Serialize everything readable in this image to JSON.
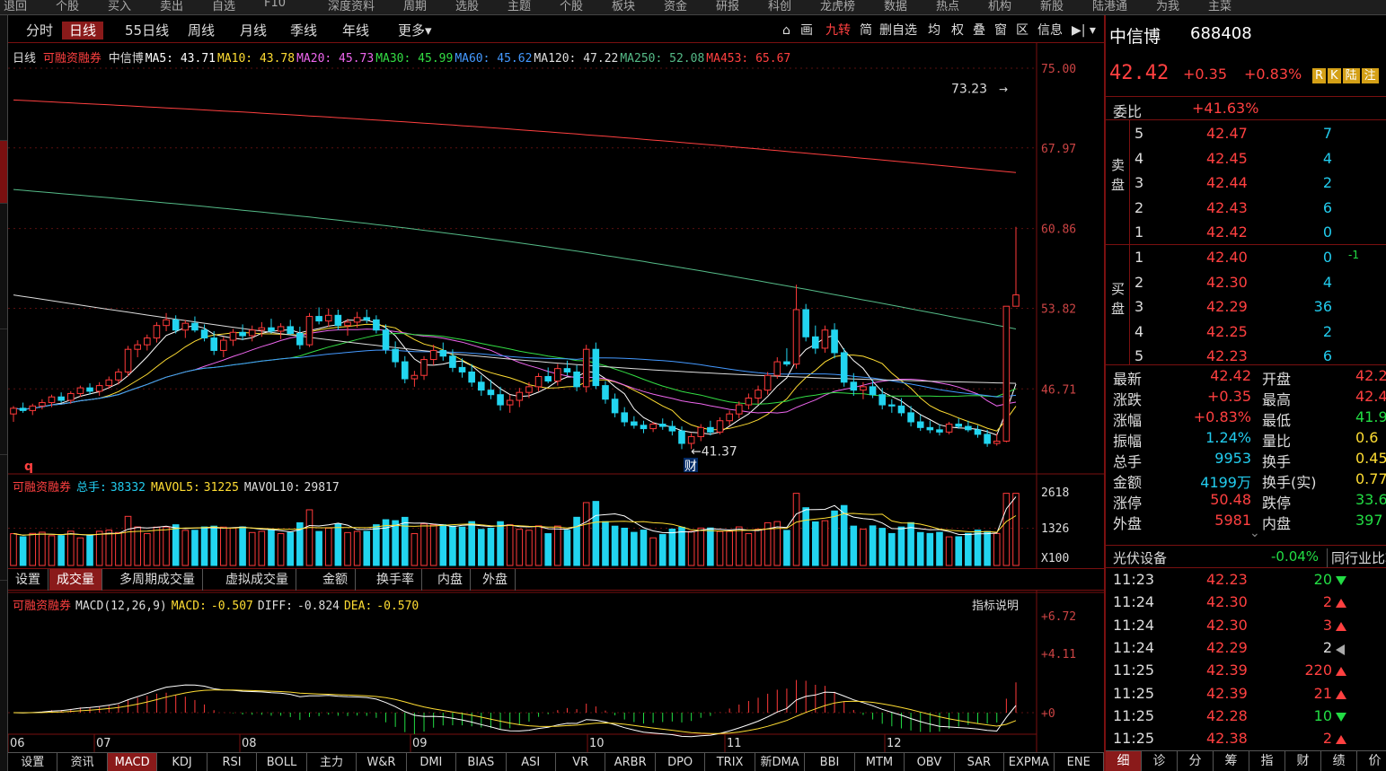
{
  "top_menu": [
    "退回",
    "个股",
    "买入",
    "卖出",
    "自选",
    "F10",
    "深度资料",
    "周期",
    "选股",
    "主题",
    "个股",
    "板块",
    "资金",
    "研报",
    "科创",
    "龙虎榜",
    "数据",
    "热点",
    "机构",
    "新股",
    "陆港通",
    "为我",
    "主菜"
  ],
  "period_tabs": [
    {
      "label": "分时",
      "active": false
    },
    {
      "label": "日线",
      "active": true
    },
    {
      "label": "55日线",
      "active": false
    },
    {
      "label": "周线",
      "active": false
    },
    {
      "label": "月线",
      "active": false
    },
    {
      "label": "季线",
      "active": false
    },
    {
      "label": "年线",
      "active": false
    },
    {
      "label": "更多▾",
      "active": false
    }
  ],
  "toolbar": [
    "画",
    "九转",
    "简",
    "删自选",
    "均",
    "权",
    "叠",
    "窗",
    "区",
    "信息"
  ],
  "chart_header": {
    "period": "日线",
    "tag": "可融资融券",
    "name": "中信博",
    "ma": [
      {
        "label": "MA5:",
        "value": "43.71",
        "color": "#ffffff"
      },
      {
        "label": "MA10:",
        "value": "43.78",
        "color": "#ffdd33"
      },
      {
        "label": "MA20:",
        "value": "45.73",
        "color": "#ee66ee"
      },
      {
        "label": "MA30:",
        "value": "45.99",
        "color": "#33dd44"
      },
      {
        "label": "MA60:",
        "value": "45.62",
        "color": "#4499ff"
      },
      {
        "label": "MA120:",
        "value": "47.22",
        "color": "#dddddd"
      },
      {
        "label": "MA250:",
        "value": "52.08",
        "color": "#55bb88"
      },
      {
        "label": "MA453:",
        "value": "65.67",
        "color": "#ff4040"
      }
    ]
  },
  "price_axis": [
    "75.00",
    "67.97",
    "60.86",
    "53.82",
    "46.71"
  ],
  "annotations": {
    "high": "73.23",
    "low": "41.37",
    "fin_mark": "财",
    "q_mark": "q"
  },
  "volume_header": {
    "tag": "可融资融券",
    "total_label": "总手:",
    "total": "38332",
    "mavol5_label": "MAVOL5:",
    "mavol5": "31225",
    "mavol10_label": "MAVOL10:",
    "mavol10": "29817"
  },
  "volume_axis": [
    "2618",
    "1326",
    "X100"
  ],
  "volume_tabs": [
    {
      "label": "设置",
      "active": false
    },
    {
      "label": "成交量",
      "active": true
    },
    {
      "label": "多周期成交量",
      "active": false
    },
    {
      "label": "虚拟成交量",
      "active": false
    },
    {
      "label": "金额",
      "active": false
    },
    {
      "label": "换手率",
      "active": false
    },
    {
      "label": "内盘",
      "active": false
    },
    {
      "label": "外盘",
      "active": false
    }
  ],
  "macd_header": {
    "tag": "可融资融券",
    "name": "MACD(12,26,9)",
    "macd_label": "MACD:",
    "macd": "-0.507",
    "diff_label": "DIFF:",
    "diff": "-0.824",
    "dea_label": "DEA:",
    "dea": "-0.570",
    "explain": "指标说明"
  },
  "macd_axis": [
    "+6.72",
    "+4.11",
    "+0"
  ],
  "date_axis": [
    "06",
    "07",
    "08",
    "09",
    "10",
    "11",
    "12"
  ],
  "indicator_tabs": [
    {
      "label": "设置",
      "active": false
    },
    {
      "label": "资讯",
      "active": false
    },
    {
      "label": "MACD",
      "active": true
    },
    {
      "label": "KDJ",
      "active": false
    },
    {
      "label": "RSI",
      "active": false
    },
    {
      "label": "BOLL",
      "active": false
    },
    {
      "label": "主力",
      "active": false
    },
    {
      "label": "W&R",
      "active": false
    },
    {
      "label": "DMI",
      "active": false
    },
    {
      "label": "BIAS",
      "active": false
    },
    {
      "label": "ASI",
      "active": false
    },
    {
      "label": "VR",
      "active": false
    },
    {
      "label": "ARBR",
      "active": false
    },
    {
      "label": "DPO",
      "active": false
    },
    {
      "label": "TRIX",
      "active": false
    },
    {
      "label": "新DMA",
      "active": false
    },
    {
      "label": "BBI",
      "active": false
    },
    {
      "label": "MTM",
      "active": false
    },
    {
      "label": "OBV",
      "active": false
    },
    {
      "label": "SAR",
      "active": false
    },
    {
      "label": "EXPMA",
      "active": false
    },
    {
      "label": "ENE",
      "active": false
    }
  ],
  "stock": {
    "name": "中信博",
    "code": "688408",
    "price": "42.42",
    "change": "+0.35",
    "pct": "+0.83%",
    "badges": [
      "R",
      "K",
      "陆",
      "注"
    ]
  },
  "order_book": {
    "weibi_label": "委比",
    "weibi": "+41.63%",
    "sell_label": "卖盘",
    "buy_label": "买盘",
    "sell": [
      {
        "lvl": "5",
        "price": "42.47",
        "vol": "7"
      },
      {
        "lvl": "4",
        "price": "42.45",
        "vol": "4"
      },
      {
        "lvl": "3",
        "price": "42.44",
        "vol": "2"
      },
      {
        "lvl": "2",
        "price": "42.43",
        "vol": "6"
      },
      {
        "lvl": "1",
        "price": "42.42",
        "vol": "0"
      }
    ],
    "buy": [
      {
        "lvl": "1",
        "price": "42.40",
        "vol": "0",
        "extra": "-1"
      },
      {
        "lvl": "2",
        "price": "42.30",
        "vol": "4"
      },
      {
        "lvl": "3",
        "price": "42.29",
        "vol": "36"
      },
      {
        "lvl": "4",
        "price": "42.25",
        "vol": "2"
      },
      {
        "lvl": "5",
        "price": "42.23",
        "vol": "6"
      }
    ]
  },
  "quote_stats": [
    {
      "l1": "最新",
      "v1": "42.42",
      "c1": "red",
      "l2": "开盘",
      "v2": "42.2",
      "c2": "red"
    },
    {
      "l1": "涨跌",
      "v1": "+0.35",
      "c1": "red",
      "l2": "最高",
      "v2": "42.4",
      "c2": "red"
    },
    {
      "l1": "涨幅",
      "v1": "+0.83%",
      "c1": "red",
      "l2": "最低",
      "v2": "41.9",
      "c2": "grn"
    },
    {
      "l1": "振幅",
      "v1": "1.24%",
      "c1": "cyan",
      "l2": "量比",
      "v2": "0.6",
      "c2": "yellow"
    },
    {
      "l1": "总手",
      "v1": "9953",
      "c1": "cyan",
      "l2": "换手",
      "v2": "0.45",
      "c2": "yellow"
    },
    {
      "l1": "金额",
      "v1": "4199万",
      "c1": "cyan",
      "l2": "换手(实)",
      "v2": "0.77",
      "c2": "yellow"
    },
    {
      "l1": "涨停",
      "v1": "50.48",
      "c1": "red",
      "l2": "跌停",
      "v2": "33.6",
      "c2": "grn"
    },
    {
      "l1": "外盘",
      "v1": "5981",
      "c1": "red",
      "l2": "内盘",
      "v2": "397",
      "c2": "grn"
    }
  ],
  "industry": {
    "name": "光伏设备",
    "pct": "-0.04%",
    "compare": "同行业比较"
  },
  "ticks": [
    {
      "time": "11:23",
      "price": "42.23",
      "pcolor": "red",
      "vol": "20",
      "vcolor": "grn",
      "dir": "down"
    },
    {
      "time": "11:24",
      "price": "42.30",
      "pcolor": "red",
      "vol": "2",
      "vcolor": "red",
      "dir": "up"
    },
    {
      "time": "11:24",
      "price": "42.30",
      "pcolor": "red",
      "vol": "3",
      "vcolor": "red",
      "dir": "up"
    },
    {
      "time": "11:24",
      "price": "42.29",
      "pcolor": "red",
      "vol": "2",
      "vcolor": "white",
      "dir": "left"
    },
    {
      "time": "11:25",
      "price": "42.39",
      "pcolor": "red",
      "vol": "220",
      "vcolor": "red",
      "dir": "up"
    },
    {
      "time": "11:25",
      "price": "42.39",
      "pcolor": "red",
      "vol": "21",
      "vcolor": "red",
      "dir": "up"
    },
    {
      "time": "11:25",
      "price": "42.28",
      "pcolor": "red",
      "vol": "10",
      "vcolor": "grn",
      "dir": "down"
    },
    {
      "time": "11:25",
      "price": "42.38",
      "pcolor": "red",
      "vol": "2",
      "vcolor": "red",
      "dir": "up"
    }
  ],
  "right_bottom_tabs": [
    {
      "label": "细",
      "active": true
    },
    {
      "label": "诊",
      "active": false
    },
    {
      "label": "分",
      "active": false
    },
    {
      "label": "筹",
      "active": false
    },
    {
      "label": "指",
      "active": false
    },
    {
      "label": "财",
      "active": false
    },
    {
      "label": "绩",
      "active": false
    },
    {
      "label": "价",
      "active": false
    }
  ],
  "chart_data": {
    "type": "candlestick",
    "ylim": [
      40,
      75
    ],
    "x_labels": [
      "06",
      "07",
      "08",
      "09",
      "10",
      "11",
      "12"
    ],
    "candles": [
      [
        44.5,
        45.2,
        43.8,
        45.0
      ],
      [
        45.0,
        45.5,
        44.6,
        44.8
      ],
      [
        44.8,
        45.4,
        44.4,
        45.2
      ],
      [
        45.2,
        45.8,
        44.9,
        45.5
      ],
      [
        45.5,
        46.2,
        45.1,
        46.0
      ],
      [
        46.0,
        46.4,
        45.5,
        45.7
      ],
      [
        45.7,
        46.5,
        45.4,
        46.3
      ],
      [
        46.3,
        47.0,
        46.0,
        46.8
      ],
      [
        46.8,
        47.2,
        46.2,
        46.5
      ],
      [
        46.5,
        47.3,
        46.1,
        47.0
      ],
      [
        47.0,
        47.8,
        46.7,
        47.5
      ],
      [
        47.5,
        48.5,
        47.1,
        48.2
      ],
      [
        48.2,
        50.5,
        47.8,
        50.2
      ],
      [
        50.2,
        51.0,
        49.5,
        50.6
      ],
      [
        50.6,
        51.5,
        50.1,
        51.2
      ],
      [
        51.2,
        52.6,
        50.8,
        52.3
      ],
      [
        52.3,
        53.4,
        51.8,
        52.8
      ],
      [
        52.8,
        53.2,
        51.6,
        51.9
      ],
      [
        51.9,
        52.8,
        51.2,
        52.5
      ],
      [
        52.5,
        53.1,
        51.7,
        51.9
      ],
      [
        51.9,
        52.4,
        50.9,
        51.2
      ],
      [
        51.2,
        51.8,
        49.7,
        50.1
      ],
      [
        50.1,
        51.3,
        49.5,
        51.0
      ],
      [
        51.0,
        52.0,
        50.5,
        51.7
      ],
      [
        51.7,
        52.4,
        51.0,
        51.4
      ],
      [
        51.4,
        52.3,
        50.9,
        51.9
      ],
      [
        51.9,
        52.6,
        51.3,
        52.1
      ],
      [
        52.1,
        52.9,
        51.6,
        51.8
      ],
      [
        51.8,
        52.5,
        51.1,
        52.2
      ],
      [
        52.2,
        52.8,
        51.5,
        51.6
      ],
      [
        51.6,
        52.2,
        50.2,
        50.6
      ],
      [
        50.6,
        53.4,
        50.4,
        53.1
      ],
      [
        53.1,
        53.9,
        52.4,
        52.7
      ],
      [
        52.7,
        53.8,
        52.2,
        53.2
      ],
      [
        53.2,
        53.7,
        51.9,
        52.3
      ],
      [
        52.3,
        52.9,
        51.4,
        52.6
      ],
      [
        52.6,
        53.5,
        52.1,
        53.0
      ],
      [
        53.0,
        53.7,
        52.5,
        52.8
      ],
      [
        52.8,
        53.2,
        51.6,
        51.9
      ],
      [
        51.9,
        52.4,
        49.8,
        50.2
      ],
      [
        50.2,
        50.9,
        48.6,
        49.1
      ],
      [
        49.1,
        49.6,
        47.2,
        47.6
      ],
      [
        47.6,
        48.3,
        46.9,
        47.9
      ],
      [
        47.9,
        49.6,
        47.5,
        49.3
      ],
      [
        49.3,
        50.6,
        48.8,
        50.1
      ],
      [
        50.1,
        50.8,
        49.2,
        49.6
      ],
      [
        49.6,
        50.2,
        48.2,
        48.6
      ],
      [
        48.6,
        49.4,
        47.7,
        48.2
      ],
      [
        48.2,
        48.9,
        46.9,
        47.3
      ],
      [
        47.3,
        47.9,
        46.1,
        46.6
      ],
      [
        46.6,
        47.5,
        45.8,
        46.2
      ],
      [
        46.2,
        46.9,
        44.8,
        45.3
      ],
      [
        45.3,
        46.2,
        44.6,
        45.7
      ],
      [
        45.7,
        46.8,
        45.1,
        46.4
      ],
      [
        46.4,
        47.3,
        45.9,
        46.9
      ],
      [
        46.9,
        48.1,
        46.5,
        47.8
      ],
      [
        47.8,
        48.6,
        47.2,
        47.4
      ],
      [
        47.4,
        48.9,
        47.0,
        48.5
      ],
      [
        48.5,
        49.2,
        47.9,
        48.2
      ],
      [
        48.2,
        48.8,
        46.5,
        46.9
      ],
      [
        46.9,
        50.6,
        46.4,
        50.2
      ],
      [
        50.2,
        50.8,
        46.7,
        47.0
      ],
      [
        47.0,
        47.4,
        45.4,
        45.8
      ],
      [
        45.8,
        46.3,
        44.2,
        44.6
      ],
      [
        44.6,
        45.1,
        43.4,
        43.8
      ],
      [
        43.8,
        44.3,
        43.2,
        43.5
      ],
      [
        43.5,
        43.9,
        42.8,
        43.2
      ],
      [
        43.2,
        43.8,
        42.9,
        43.6
      ],
      [
        43.6,
        44.1,
        43.1,
        43.4
      ],
      [
        43.4,
        43.9,
        42.6,
        43.0
      ],
      [
        43.0,
        43.4,
        41.4,
        41.9
      ],
      [
        41.9,
        42.8,
        41.4,
        42.5
      ],
      [
        42.5,
        43.6,
        42.1,
        43.3
      ],
      [
        43.3,
        43.9,
        42.6,
        42.9
      ],
      [
        42.9,
        44.2,
        42.7,
        43.9
      ],
      [
        43.9,
        44.8,
        43.5,
        44.5
      ],
      [
        44.5,
        45.6,
        44.1,
        45.3
      ],
      [
        45.3,
        46.3,
        44.9,
        45.9
      ],
      [
        45.9,
        47.0,
        45.4,
        46.6
      ],
      [
        46.6,
        48.2,
        46.2,
        47.9
      ],
      [
        47.9,
        49.5,
        47.6,
        49.1
      ],
      [
        49.1,
        50.3,
        48.7,
        48.9
      ],
      [
        48.9,
        55.9,
        48.5,
        53.7
      ],
      [
        53.7,
        54.2,
        50.9,
        51.3
      ],
      [
        51.3,
        52.3,
        49.8,
        50.3
      ],
      [
        50.3,
        52.3,
        49.9,
        51.9
      ],
      [
        51.9,
        52.5,
        49.4,
        49.9
      ],
      [
        49.9,
        50.3,
        46.9,
        47.3
      ],
      [
        47.3,
        48.1,
        46.1,
        46.6
      ],
      [
        46.6,
        47.3,
        45.8,
        46.9
      ],
      [
        46.9,
        47.5,
        45.9,
        46.2
      ],
      [
        46.2,
        46.8,
        44.9,
        45.3
      ],
      [
        45.3,
        45.8,
        44.6,
        45.2
      ],
      [
        45.2,
        45.9,
        44.3,
        44.6
      ],
      [
        44.6,
        45.2,
        43.4,
        43.8
      ],
      [
        43.8,
        44.4,
        43.0,
        43.3
      ],
      [
        43.3,
        43.9,
        42.8,
        43.1
      ],
      [
        43.1,
        43.6,
        42.6,
        42.9
      ],
      [
        42.9,
        43.8,
        42.7,
        43.6
      ],
      [
        43.6,
        44.1,
        43.2,
        43.4
      ],
      [
        43.4,
        43.9,
        42.9,
        43.1
      ],
      [
        43.1,
        43.5,
        42.4,
        42.7
      ],
      [
        42.7,
        43.1,
        41.6,
        41.9
      ],
      [
        41.9,
        42.8,
        41.7,
        42.1
      ],
      [
        42.1,
        54.0,
        42.0,
        54.0
      ],
      [
        54.0,
        61.0,
        54.0,
        55.0
      ]
    ]
  }
}
